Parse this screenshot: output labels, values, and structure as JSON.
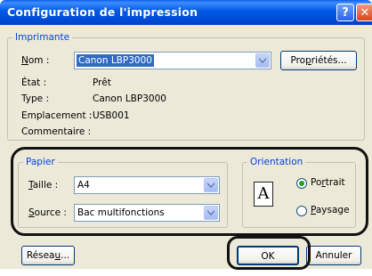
{
  "window": {
    "title": "Configuration de l'impression",
    "help_glyph": "?",
    "close_glyph": "✕"
  },
  "printer": {
    "legend": "Imprimante",
    "name_label_u": "N",
    "name_label_rest": "om :",
    "name_value": "Canon LBP3000",
    "properties_button_pre": "Pro",
    "properties_button_u": "p",
    "properties_button_post": "riétés...",
    "status_label": "État :",
    "status_value": "Prêt",
    "type_label": "Type :",
    "type_value": "Canon LBP3000",
    "location_label": "Emplacement :",
    "location_value": "USB001",
    "comment_label": "Commentaire :"
  },
  "paper": {
    "legend": "Papier",
    "size_label_u": "T",
    "size_label_rest": "aille :",
    "size_value": "A4",
    "source_label_u": "S",
    "source_label_rest": "ource :",
    "source_value": "Bac multifonctions"
  },
  "orientation": {
    "legend": "Orientation",
    "page_glyph": "A",
    "portrait_pre": "Po",
    "portrait_u": "r",
    "portrait_post": "trait",
    "portrait_selected": true,
    "landscape_u": "P",
    "landscape_post": "aysage",
    "landscape_selected": false
  },
  "footer": {
    "network_pre": "Résea",
    "network_u": "u",
    "network_post": "...",
    "ok_label": "OK",
    "cancel_label": "Annuler"
  }
}
